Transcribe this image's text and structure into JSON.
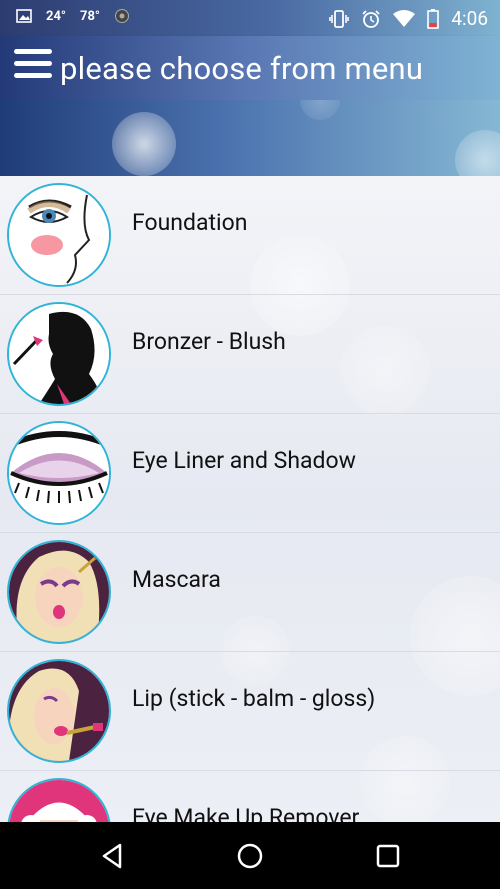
{
  "status_bar": {
    "temp_c": "24°",
    "temp_f": "78°",
    "time": "4:06",
    "icons": [
      "image-icon",
      "steam-icon",
      "vibrate-icon",
      "alarm-icon",
      "wifi-icon",
      "battery-icon"
    ]
  },
  "header": {
    "title": "please choose from menu",
    "menu_icon": "hamburger-icon"
  },
  "menu": {
    "items": [
      {
        "label": "Foundation",
        "icon": "face-eye-icon"
      },
      {
        "label": "Bronzer - Blush",
        "icon": "silhouette-brush-icon"
      },
      {
        "label": "Eye Liner and Shadow",
        "icon": "eye-shadow-icon"
      },
      {
        "label": "Mascara",
        "icon": "mascara-girl-icon"
      },
      {
        "label": "Lip (stick - balm - gloss)",
        "icon": "lipstick-girl-icon"
      },
      {
        "label": "Eye Make Up Remover",
        "icon": "remover-girl-icon"
      }
    ]
  },
  "nav": {
    "back": "back-icon",
    "home": "home-icon",
    "recents": "recents-icon"
  },
  "colors": {
    "accent_border": "#2fb4d8",
    "header_start": "#243a78",
    "header_end": "#7fb3d4"
  }
}
